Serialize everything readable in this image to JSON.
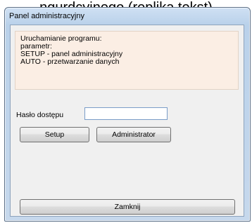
{
  "background_caption": "ngurdcyjnego (replika tekst)",
  "window": {
    "title": "Panel administracyjny"
  },
  "info_box": {
    "lines": [
      "Uruchamianie programu:",
      "parametr:",
      "SETUP - panel administracyjny",
      "AUTO -  przetwarzanie danych"
    ],
    "background_color": "#fbeee4"
  },
  "password": {
    "label": "Hasło dostępu",
    "value": "",
    "placeholder": ""
  },
  "buttons": {
    "setup": "Setup",
    "administrator": "Administrator",
    "close": "Zamknij"
  }
}
